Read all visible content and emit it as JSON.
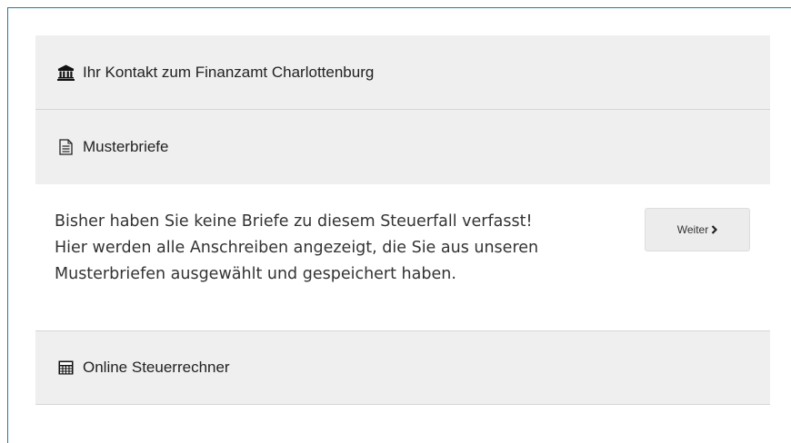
{
  "panels": {
    "kontakt": {
      "label": "Ihr Kontakt zum Finanzamt Charlottenburg",
      "icon": "bank-icon"
    },
    "musterbriefe": {
      "label": "Musterbriefe",
      "icon": "document-icon",
      "body_lines": [
        "Bisher haben Sie keine Briefe zu diesem Steuerfall verfasst!",
        "Hier werden alle Anschreiben angezeigt, die Sie aus unseren",
        "Musterbriefen ausgewählt und gespeichert haben."
      ],
      "button_label": "Weiter",
      "button_icon": "chevron-right-icon"
    },
    "rechner": {
      "label": "Online Steuerrechner",
      "icon": "calculator-icon"
    }
  },
  "colors": {
    "panel_bg": "#efefef",
    "frame_border": "#1f7aa6",
    "button_bg": "#ececec"
  }
}
